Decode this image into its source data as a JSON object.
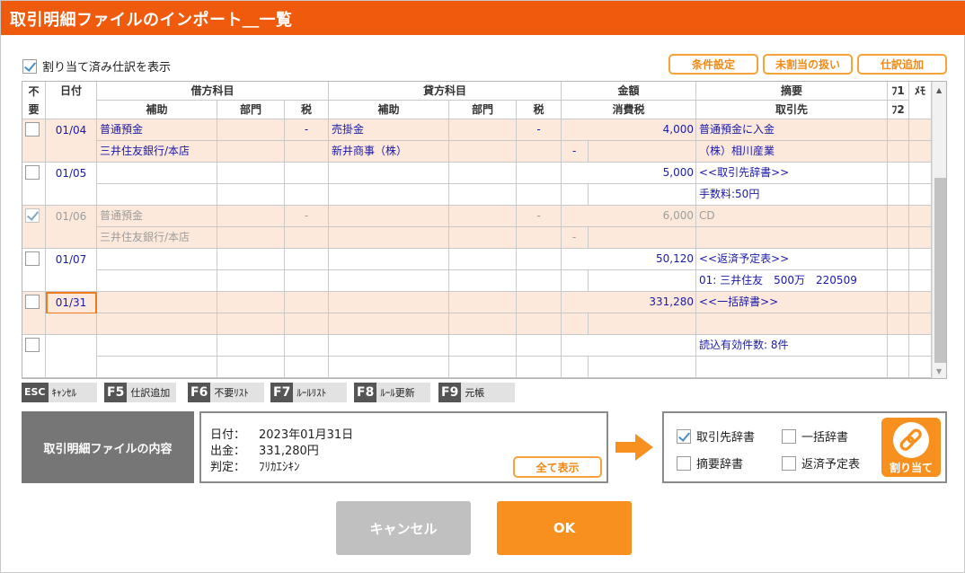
{
  "window": {
    "title": "取引明細ファイルのインポート＿一覧"
  },
  "show_assigned": {
    "label": "割り当て済み仕訳を表示",
    "checked": true
  },
  "toolbar": {
    "condition": "条件設定",
    "unassigned": "未割当の扱い",
    "add_entry": "仕訳追加"
  },
  "headers": {
    "fuyo": "不要",
    "date": "日付",
    "debit": "借方科目",
    "credit": "貸方科目",
    "amount": "金額",
    "summary": "摘要",
    "fu": "ﾌ1",
    "fu2": "ﾌ2",
    "memo": "ﾒﾓ",
    "debit_sub": "補助",
    "debit_dept": "部門",
    "debit_tax": "税",
    "credit_sub": "補助",
    "credit_dept": "部門",
    "credit_tax": "税",
    "tax": "消費税",
    "partner": "取引先"
  },
  "rows": [
    {
      "date": "01/04",
      "checked": false,
      "disabled": false,
      "selected": false,
      "pink": true,
      "debit": "普通預金",
      "debit_tax": "-",
      "credit": "売掛金",
      "credit_tax": "-",
      "amount": "4,000",
      "summary": "普通預金に入金",
      "debit_sub": "三井住友銀行/本店",
      "credit_sub": "新井商事（株）",
      "tax": "-",
      "partner": "（株）相川産業"
    },
    {
      "date": "01/05",
      "checked": false,
      "disabled": false,
      "selected": false,
      "pink": false,
      "debit": "",
      "debit_tax": "",
      "credit": "",
      "credit_tax": "",
      "amount": "5,000",
      "summary": "<<取引先辞書>>",
      "debit_sub": "",
      "credit_sub": "",
      "tax": "",
      "partner": "手数料:50円"
    },
    {
      "date": "01/06",
      "checked": true,
      "disabled": true,
      "selected": false,
      "pink": true,
      "debit": "普通預金",
      "debit_tax": "-",
      "credit": "",
      "credit_tax": "-",
      "amount": "6,000",
      "summary": "CD",
      "debit_sub": "三井住友銀行/本店",
      "credit_sub": "",
      "tax": "-",
      "partner": ""
    },
    {
      "date": "01/07",
      "checked": false,
      "disabled": false,
      "selected": false,
      "pink": false,
      "debit": "",
      "debit_tax": "",
      "credit": "",
      "credit_tax": "",
      "amount": "50,120",
      "summary": "<<返済予定表>>",
      "debit_sub": "",
      "credit_sub": "",
      "tax": "",
      "partner": "01: 三井住友　500万　220509"
    },
    {
      "date": "01/31",
      "checked": false,
      "disabled": false,
      "selected": true,
      "pink": true,
      "debit": "",
      "debit_tax": "",
      "credit": "",
      "credit_tax": "",
      "amount": "331,280",
      "summary": "<<一括辞書>>",
      "debit_sub": "",
      "credit_sub": "",
      "tax": "",
      "partner": ""
    },
    {
      "date": "",
      "checked": false,
      "disabled": false,
      "selected": false,
      "pink": false,
      "debit": "",
      "debit_tax": "",
      "credit": "",
      "credit_tax": "",
      "amount": "",
      "summary": "読込有効件数: 8件",
      "debit_sub": "",
      "credit_sub": "",
      "tax": "",
      "partner": ""
    }
  ],
  "fkeys": [
    {
      "key": "ESC",
      "label": "ｷｬﾝｾﾙ"
    },
    {
      "key": "F5",
      "label": "仕訳追加"
    },
    {
      "key": "F6",
      "label": "不要ﾘｽﾄ"
    },
    {
      "key": "F7",
      "label": "ﾙｰﾙﾘｽﾄ"
    },
    {
      "key": "F8",
      "label": "ﾙｰﾙ更新"
    },
    {
      "key": "F9",
      "label": "元帳"
    }
  ],
  "detail": {
    "box_label": "取引明細ファイルの内容",
    "date_label": "日付：",
    "date_value": "2023年01月31日",
    "out_label": "出金：",
    "out_value": "331,280円",
    "judge_label": "判定：",
    "judge_value": "ﾌﾘｶｴｼｷﾝ",
    "show_all": "全て表示"
  },
  "dicts": [
    {
      "label": "取引先辞書",
      "checked": true
    },
    {
      "label": "一括辞書",
      "checked": false
    },
    {
      "label": "摘要辞書",
      "checked": false
    },
    {
      "label": "返済予定表",
      "checked": false
    }
  ],
  "assign": {
    "label": "割り当て",
    "icon": "link-icon"
  },
  "buttons": {
    "cancel": "キャンセル",
    "ok": "OK"
  },
  "colors": {
    "title": "#ef5a0c",
    "accent": "#f7901e",
    "pink_row": "#fde9dc",
    "link_text": "#1a1aa8"
  }
}
